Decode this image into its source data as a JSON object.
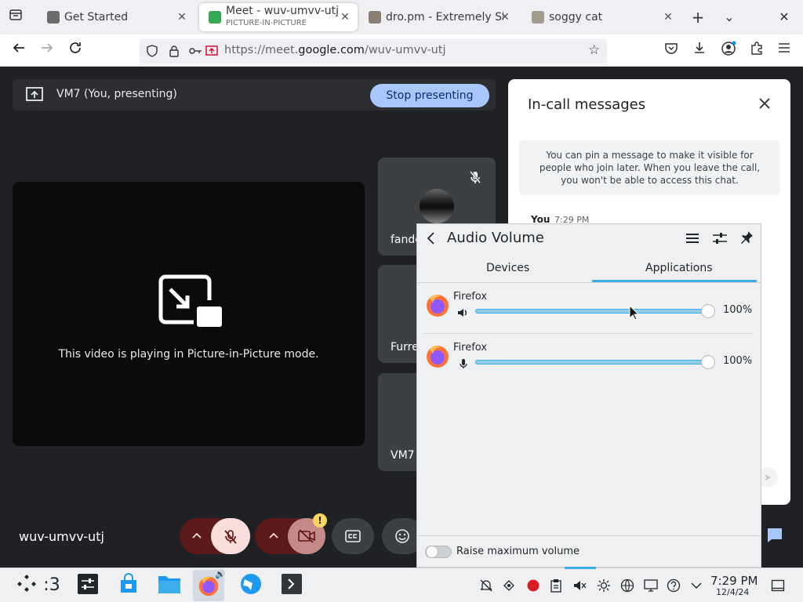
{
  "browser": {
    "tabs": [
      {
        "title": "Get Started",
        "subtitle": ""
      },
      {
        "title": "Meet - wuv-umvv-utj",
        "subtitle": "PICTURE-IN-PICTURE"
      },
      {
        "title": "dro.pm - Extremely Sh",
        "subtitle": ""
      },
      {
        "title": "soggy cat",
        "subtitle": ""
      }
    ],
    "new_tab_symbol": "+",
    "tab_list_symbol": "⌄",
    "close_symbol": "✕",
    "url_prefix": "https://meet.",
    "url_domain": "google.com",
    "url_path": "/wuv-umvv-utj"
  },
  "meet": {
    "presenter_label": "VM7 (You, presenting)",
    "stop_presenting_label": "Stop presenting",
    "pip_message": "This video is playing in Picture-in-Picture mode.",
    "participants": [
      {
        "name": "fando"
      },
      {
        "name": "Furre"
      },
      {
        "name": "VM7"
      }
    ],
    "meeting_code": "wuv-umvv-utj",
    "camera_warning_badge": "!"
  },
  "chat": {
    "title": "In-call messages",
    "info": "You can pin a message to make it visible for people who join later. When you leave the call, you won't be able to access this chat.",
    "author": "You",
    "time": "7:29 PM"
  },
  "audio_volume": {
    "title": "Audio Volume",
    "tabs": [
      "Devices",
      "Applications"
    ],
    "active_tab": "Applications",
    "apps": [
      {
        "name": "Firefox",
        "icon": "speaker-icon",
        "percent_label": "100%",
        "level": 1.0
      },
      {
        "name": "Firefox",
        "icon": "microphone-icon",
        "percent_label": "100%",
        "level": 1.0
      }
    ],
    "raise_max_label": "Raise maximum volume",
    "raise_max_enabled": false
  },
  "taskbar": {
    "workspace_label": ":3",
    "clock_time": "7:29 PM",
    "clock_date": "12/4/24"
  },
  "colors": {
    "meet_bg": "#202124",
    "stop_button": "#a8c7fa",
    "mic_muted": "#f9dedc",
    "kde_accent": "#3daee9",
    "record_red": "#da1e28"
  }
}
